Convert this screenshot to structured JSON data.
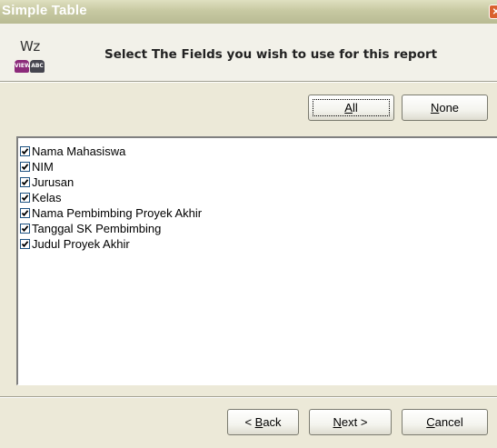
{
  "window": {
    "title": "Simple Table",
    "close_icon": "close-icon"
  },
  "header": {
    "logo_text": "Wz",
    "logo_badges": [
      "VIEW",
      "ABC"
    ],
    "instruction": "Select The Fields you wish to use for this report"
  },
  "selection_buttons": {
    "all": {
      "prefix": "",
      "mnemonic": "A",
      "rest": "ll"
    },
    "none": {
      "prefix": "",
      "mnemonic": "N",
      "rest": "one"
    }
  },
  "fields": [
    {
      "label": "Nama Mahasiswa",
      "checked": true
    },
    {
      "label": "NIM",
      "checked": true
    },
    {
      "label": "Jurusan",
      "checked": true
    },
    {
      "label": "Kelas",
      "checked": true
    },
    {
      "label": "Nama Pembimbing Proyek Akhir",
      "checked": true
    },
    {
      "label": "Tanggal SK Pembimbing",
      "checked": true
    },
    {
      "label": "Judul Proyek Akhir",
      "checked": true
    }
  ],
  "footer_buttons": {
    "back": {
      "prefix": "< ",
      "mnemonic": "B",
      "rest": "ack"
    },
    "next": {
      "prefix": "",
      "mnemonic": "N",
      "rest": "ext >"
    },
    "cancel": {
      "prefix": "",
      "mnemonic": "C",
      "rest": "ancel"
    }
  },
  "colors": {
    "titlebar": "#c7c9a2",
    "dialog_bg": "#ece9d8",
    "header_bg": "#f2f1e9",
    "checkbox_border": "#1c5180"
  }
}
